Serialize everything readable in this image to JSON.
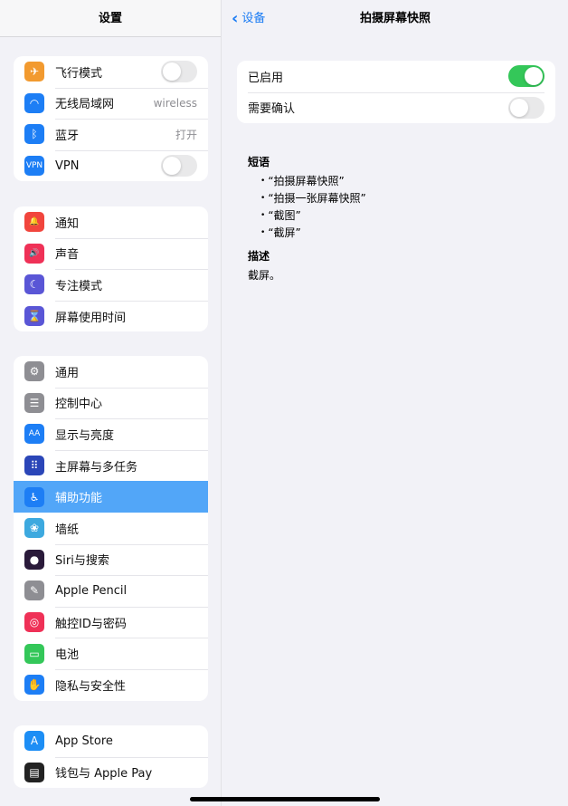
{
  "sidebar": {
    "title": "设置",
    "groups": [
      [
        {
          "label": "飞行模式",
          "icon": "airplane-icon",
          "color": "#f29a2f",
          "glyph": "✈",
          "toggle": false
        },
        {
          "label": "无线局域网",
          "icon": "wifi-icon",
          "color": "#1d7ef5",
          "glyph": "◠",
          "value": "wireless"
        },
        {
          "label": "蓝牙",
          "icon": "bluetooth-icon",
          "color": "#1d7ef5",
          "glyph": "ᛒ",
          "value": "打开"
        },
        {
          "label": "VPN",
          "icon": "vpn-icon",
          "color": "#1d7ef5",
          "glyph": "VPN",
          "toggle": false
        }
      ],
      [
        {
          "label": "通知",
          "icon": "notification-bell-icon",
          "color": "#f1453d",
          "glyph": "🔔"
        },
        {
          "label": "声音",
          "icon": "speaker-icon",
          "color": "#ef3157",
          "glyph": "🔊"
        },
        {
          "label": "专注模式",
          "icon": "moon-icon",
          "color": "#5a56d6",
          "glyph": "☾"
        },
        {
          "label": "屏幕使用时间",
          "icon": "hourglass-icon",
          "color": "#5a56d6",
          "glyph": "⌛"
        }
      ],
      [
        {
          "label": "通用",
          "icon": "gear-icon",
          "color": "#8e8e93",
          "glyph": "⚙"
        },
        {
          "label": "控制中心",
          "icon": "control-center-icon",
          "color": "#8e8e93",
          "glyph": "☰"
        },
        {
          "label": "显示与亮度",
          "icon": "display-brightness-icon",
          "color": "#1d7ef5",
          "glyph": "AA"
        },
        {
          "label": "主屏幕与多任务",
          "icon": "home-screen-icon",
          "color": "#2b46b8",
          "glyph": "⠿"
        },
        {
          "label": "辅助功能",
          "icon": "accessibility-icon",
          "color": "#1d7ef5",
          "glyph": "♿",
          "selected": true
        },
        {
          "label": "墙纸",
          "icon": "wallpaper-flower-icon",
          "color": "#3da9df",
          "glyph": "❀"
        },
        {
          "label": "Siri与搜索",
          "icon": "siri-icon",
          "color": "#2a1a3a",
          "glyph": "●"
        },
        {
          "label": "Apple Pencil",
          "icon": "pencil-icon",
          "color": "#8e8e93",
          "glyph": "✎"
        },
        {
          "label": "触控ID与密码",
          "icon": "fingerprint-icon",
          "color": "#ef3157",
          "glyph": "◎"
        },
        {
          "label": "电池",
          "icon": "battery-icon",
          "color": "#34c759",
          "glyph": "▭"
        },
        {
          "label": "隐私与安全性",
          "icon": "privacy-hand-icon",
          "color": "#1d7ef5",
          "glyph": "✋"
        }
      ],
      [
        {
          "label": "App Store",
          "icon": "app-store-icon",
          "color": "#1d8ef5",
          "glyph": "A"
        },
        {
          "label": "钱包与 Apple Pay",
          "icon": "wallet-icon",
          "color": "#222222",
          "glyph": "▤"
        }
      ]
    ]
  },
  "detail": {
    "back_label": "设备",
    "title": "拍摄屏幕快照",
    "settings": [
      {
        "label": "已启用",
        "toggle": true
      },
      {
        "label": "需要确认",
        "toggle": false
      }
    ],
    "phrases_heading": "短语",
    "phrases": [
      "“拍摄屏幕快照”",
      "“拍摄一张屏幕快照”",
      "“截图”",
      "“截屏”"
    ],
    "description_heading": "描述",
    "description": "截屏。"
  }
}
